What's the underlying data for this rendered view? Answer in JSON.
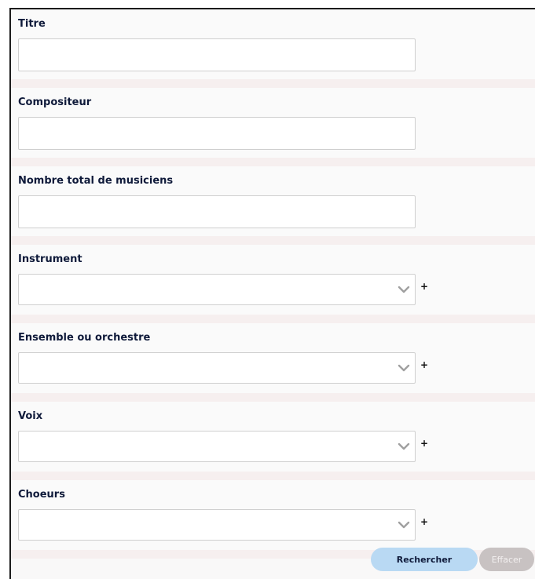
{
  "form": {
    "titre": {
      "label": "Titre",
      "value": ""
    },
    "compositeur": {
      "label": "Compositeur",
      "value": ""
    },
    "nombre": {
      "label": "Nombre total de musiciens",
      "value": ""
    },
    "instrument": {
      "label": "Instrument",
      "selected": "",
      "add": "+"
    },
    "ensemble": {
      "label": "Ensemble ou orchestre",
      "selected": "",
      "add": "+"
    },
    "voix": {
      "label": "Voix",
      "selected": "",
      "add": "+"
    },
    "choeurs": {
      "label": "Choeurs",
      "selected": "",
      "add": "+"
    }
  },
  "actions": {
    "search_label": "Rechercher",
    "clear_label": "Effacer"
  },
  "colors": {
    "label_text": "#0f1a3a",
    "search_button": "#b9d9f3",
    "clear_button": "#c8c2c2",
    "band": "#f6efef"
  },
  "icons": {
    "select_arrow": "chevron-down-icon",
    "add": "plus-icon"
  }
}
